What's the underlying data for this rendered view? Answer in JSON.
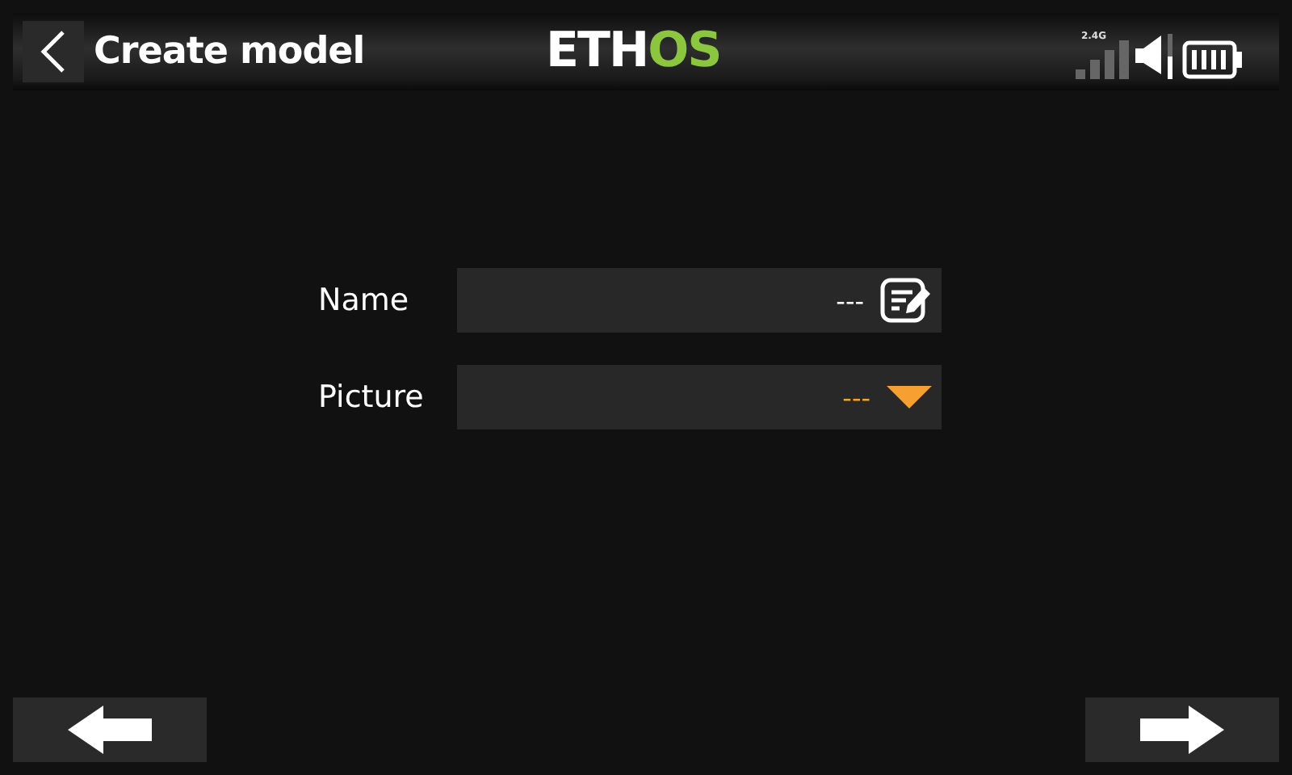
{
  "header": {
    "title": "Create model",
    "logo": [
      {
        "text": "ETH",
        "color": "#ffffff"
      },
      {
        "text": "OS",
        "color": "#8cc63f"
      }
    ],
    "band": "2.4G"
  },
  "fields": [
    {
      "label": "Name",
      "kind": "text",
      "value": "---"
    },
    {
      "label": "Picture",
      "kind": "choice",
      "value": "---"
    }
  ]
}
